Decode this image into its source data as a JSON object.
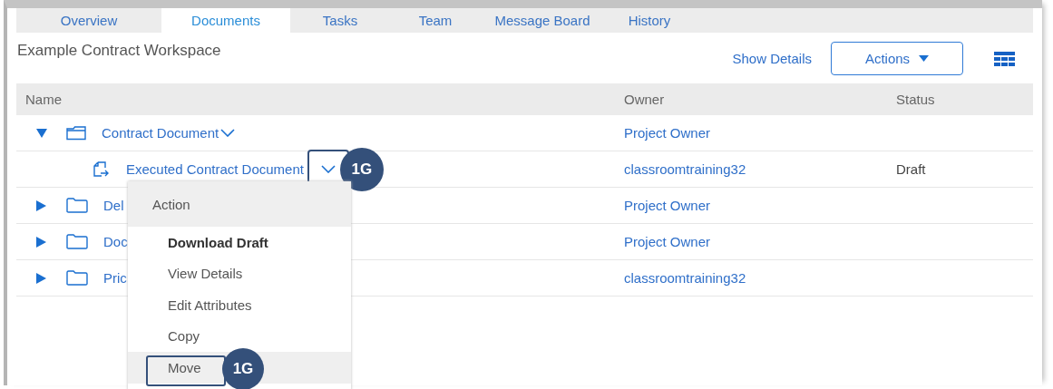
{
  "tabs": [
    {
      "label": "Overview",
      "selected": false
    },
    {
      "label": "Documents",
      "selected": true
    },
    {
      "label": "Tasks",
      "selected": false
    },
    {
      "label": "Team",
      "selected": false
    },
    {
      "label": "Message Board",
      "selected": false
    },
    {
      "label": "History",
      "selected": false
    }
  ],
  "workspace_title": "Example Contract Workspace",
  "toolbar": {
    "show_details": "Show Details",
    "actions_button": "Actions"
  },
  "table": {
    "columns": [
      "Name",
      "Owner",
      "Status"
    ],
    "rows": [
      {
        "kind": "folder",
        "name": "Contract Document",
        "owner": "Project Owner",
        "expanded": true,
        "chevron": true,
        "children": [
          {
            "kind": "document",
            "name": "Executed Contract Document",
            "owner": "classroomtraining32",
            "status": "Draft",
            "chevron": true,
            "callout": "1G"
          }
        ]
      },
      {
        "kind": "folder",
        "name": "Del",
        "owner": "Project Owner",
        "expanded": false
      },
      {
        "kind": "folder",
        "name": "Doc",
        "owner": "Project Owner",
        "expanded": false
      },
      {
        "kind": "folder",
        "name": "Pric",
        "owner": "classroomtraining32",
        "expanded": false
      }
    ]
  },
  "action_menu": {
    "title": "Action",
    "items": [
      {
        "label": "Download Draft",
        "default": true,
        "selected": false
      },
      {
        "label": "View Details",
        "default": false,
        "selected": false
      },
      {
        "label": "Edit Attributes",
        "default": false,
        "selected": false
      },
      {
        "label": "Copy",
        "default": false,
        "selected": false
      },
      {
        "label": "Move",
        "default": false,
        "selected": true,
        "callout": "1G"
      }
    ]
  }
}
